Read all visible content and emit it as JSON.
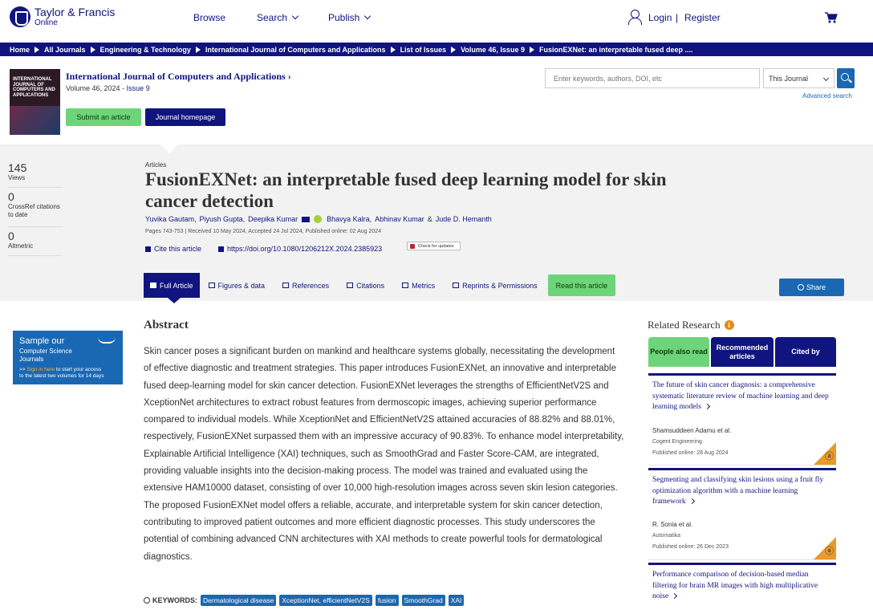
{
  "header": {
    "logo_line1": "Taylor & Francis",
    "logo_line2": "Online",
    "nav": [
      "Browse",
      "Search",
      "Publish"
    ],
    "login": "Login",
    "separator": "|",
    "register": "Register"
  },
  "breadcrumbs": [
    "Home",
    "All Journals",
    "Engineering & Technology",
    "International Journal of Computers and Applications",
    "List of Issues",
    "Volume 46, Issue 9",
    "FusionEXNet: an interpretable fused deep ...."
  ],
  "journal": {
    "cover_text": "INTERNATIONAL JOURNAL OF COMPUTERS AND APPLICATIONS",
    "title": "International Journal of Computers and Applications",
    "volume": "Volume 46, 2024 - ",
    "issue": "Issue 9",
    "submit_label": "Submit an article",
    "homepage_label": "Journal homepage"
  },
  "search": {
    "placeholder": "Enter keywords, authors, DOI, etc",
    "scope": "This Journal",
    "advanced": "Advanced search"
  },
  "metrics": [
    {
      "value": "145",
      "label": "Views"
    },
    {
      "value": "0",
      "label": "CrossRef citations to date"
    },
    {
      "value": "0",
      "label": "Altmetric"
    }
  ],
  "article": {
    "type": "Articles",
    "title": "FusionEXNet: an interpretable fused deep learning model for skin cancer detection",
    "authors": [
      "Yuvika Gautam",
      "Piyush Gupta",
      "Deepika Kumar",
      "Bhavya Kalra",
      "Abhinav Kumar",
      "Jude D. Hemanth"
    ],
    "author_amp": "&",
    "pub_info": "Pages 743-753 | Received 10 May 2024, Accepted 24 Jul 2024, Published online: 02 Aug 2024",
    "cite_label": "Cite this article",
    "doi": "https://doi.org/10.1080/1206212X.2024.2385923",
    "check_updates": "Check for updates"
  },
  "tabs": [
    "Full Article",
    "Figures & data",
    "References",
    "Citations",
    "Metrics",
    "Reprints & Permissions"
  ],
  "read_label": "Read this article",
  "share_label": "Share",
  "promo": {
    "line1": "Sample our",
    "line2": "Computer Science Journals",
    "line3_prefix": ">> ",
    "line3_link": "Sign in here",
    "line3_suffix": " to start your access",
    "line4": "to the latest two volumes for 14 days"
  },
  "abstract": {
    "heading": "Abstract",
    "body": "Skin cancer poses a significant burden on mankind and healthcare systems globally, necessitating the development of effective diagnostic and treatment strategies. This paper introduces FusionEXNet, an innovative and interpretable fused deep-learning model for skin cancer detection. FusionEXNet leverages the strengths of EfficientNetV2S and XceptionNet architectures to extract robust features from dermoscopic images, achieving superior performance compared to individual models. While XceptionNet and EfficientNetV2S attained accuracies of 88.82% and 88.01%, respectively, FusionEXNet surpassed them with an impressive accuracy of 90.83%. To enhance model interpretability, Explainable Artificial Intelligence (XAI) techniques, such as SmoothGrad and Faster Score-CAM, are integrated, providing valuable insights into the decision-making process. The model was trained and evaluated using the extensive HAM10000 dataset, consisting of over 10,000 high-resolution images across seven skin lesion categories. The proposed FusionEXNet model offers a reliable, accurate, and interpretable system for skin cancer detection, contributing to improved patient outcomes and more efficient diagnostic processes. This study underscores the potential of combining advanced CNN architectures with XAI methods to create powerful tools for dermatological diagnostics."
  },
  "keywords": {
    "label": "KEYWORDS:",
    "items": [
      "Dermatological disease",
      "XceptionNet, efficientNetV2S",
      "fusion",
      "SmoothGrad",
      "XAI"
    ]
  },
  "related": {
    "heading": "Related Research",
    "info_glyph": "i",
    "tabs": [
      "People also read",
      "Recommended articles",
      "Cited by"
    ],
    "items": [
      {
        "title": "The future of skin cancer diagnosis: a comprehensive systematic literature review of machine learning and deep learning models",
        "authors": "Shamsuddeen Adamu et al.",
        "journal": "Cogent Engineering",
        "date": "Published online: 28 Aug 2024"
      },
      {
        "title": "Segmenting and classifying skin lesions using a fruit fly optimization algorithm with a machine learning framework",
        "authors": "R. Sonia et al.",
        "journal": "Automatika",
        "date": "Published online: 26 Dec 2023"
      },
      {
        "title": "Performance comparison of decision-based median filtering for brain MR images with high multiplicative noise",
        "authors": "",
        "journal": "",
        "date": ""
      }
    ]
  }
}
